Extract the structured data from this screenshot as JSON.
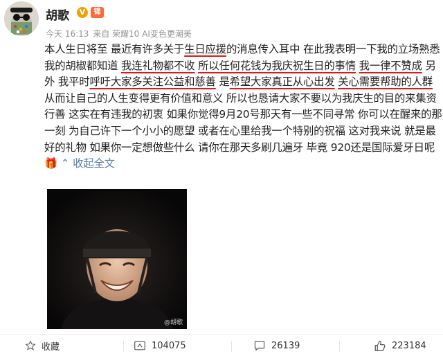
{
  "post": {
    "username": "胡歌",
    "vip_badge": "V",
    "level_badge": "锦",
    "time": "今天 16:13",
    "source": "来自 荣耀10 AI变色更潮美",
    "text": {
      "p01": "本人生日将至 最近有许多关于",
      "p02": "生日应援",
      "p03": "的消息传入耳中 在此我表明一下我的立场",
      "p04": "熟悉我的胡椒都知道 ",
      "p05": "我连礼物都不收",
      "p06": " ",
      "p07": "所以任何花钱为我庆祝生日的事情",
      "p08": " ",
      "p09": "我一律不赞成",
      "p10": " 另外 我平时",
      "p11": "呼吁大家多关注公益和慈善",
      "p12": " 是",
      "p13": "希望大家真正从心出发",
      "p14": " ",
      "p15": "关心需要帮助的人群",
      "p16": " 从而让自己的人生变得更有价值和意义 所以也恳请大家不要以为我庆生的目的来集资行善 这实在有违我的初衷 如果你觉得9月20号那天有一些不同寻常 你可以在醒来的那一刻 为自己许下一个小小的愿望 或者在心里给我一个特别的祝福 这对我来说 就是最好的礼物 如果你一定想做些什么 请你在那天多刷几遍牙 毕竟 920还是国际爱牙日呢",
      "emoji": "🎁",
      "collapse": "收起全文"
    },
    "image_watermark": "@胡歌"
  },
  "actions": {
    "favorite_label": "收藏",
    "repost_count": "104075",
    "comment_count": "26139",
    "like_count": "223184"
  },
  "colors": {
    "accent_link": "#5a7fa8",
    "underline_red": "#e0161b",
    "meta_gray": "#939393"
  },
  "icons": [
    "star-icon",
    "repost-icon",
    "comment-icon",
    "like-icon"
  ]
}
